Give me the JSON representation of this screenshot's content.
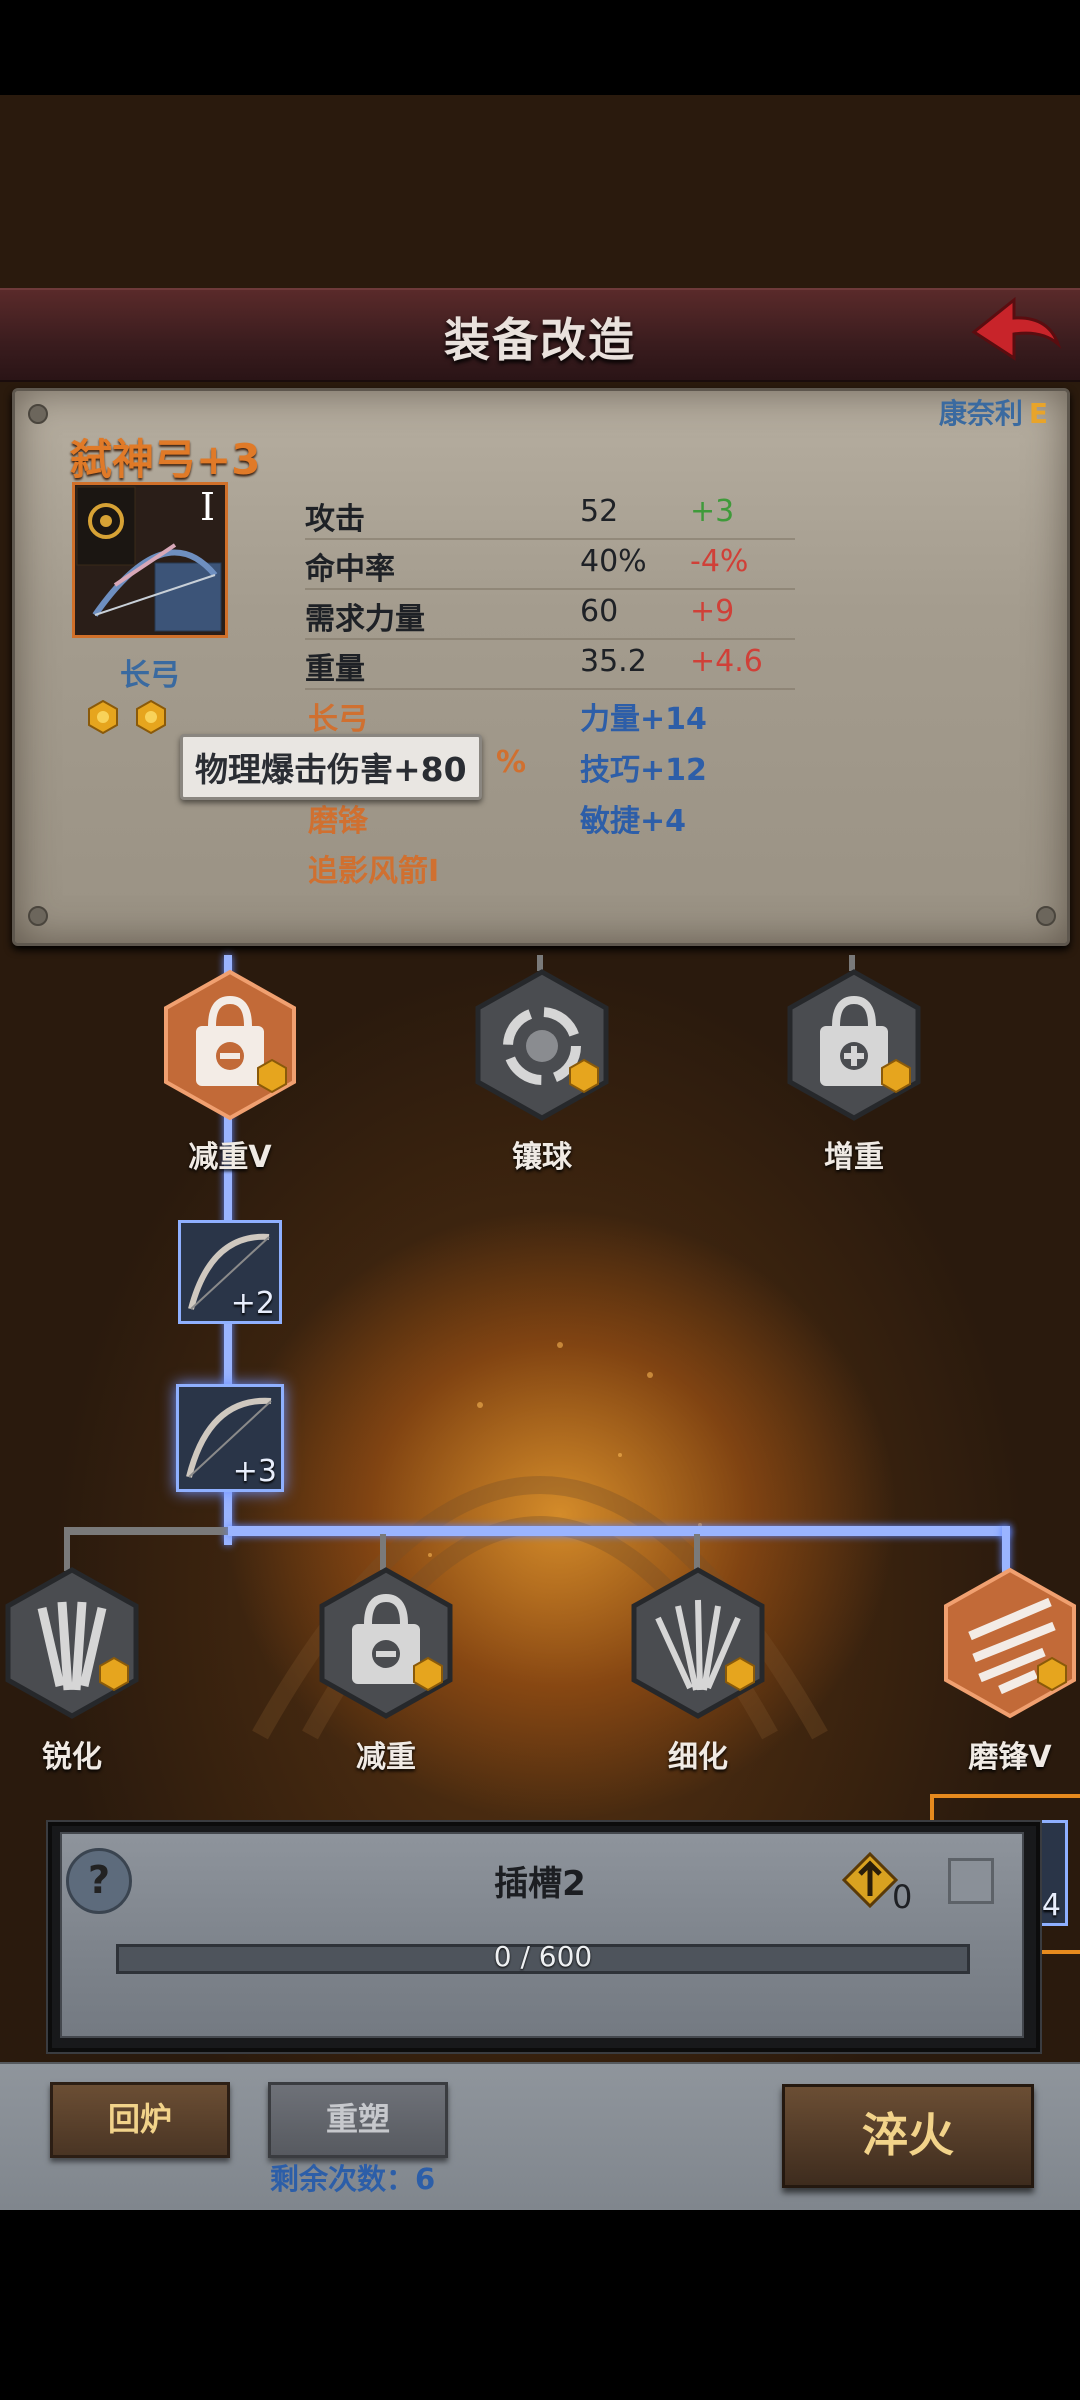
{
  "header": {
    "title": "装备改造"
  },
  "item": {
    "name": "弑神弓+3",
    "owner": "康奈利",
    "owner_grade": "E",
    "tier": "I",
    "type": "长弓"
  },
  "stats": [
    {
      "label": "攻击",
      "value": "52",
      "delta": "+3",
      "kind": "pos"
    },
    {
      "label": "命中率",
      "value": "40%",
      "delta": "-4%",
      "kind": "neg"
    },
    {
      "label": "需求力量",
      "value": "60",
      "delta": "+9",
      "kind": "neg"
    },
    {
      "label": "重量",
      "value": "35.2",
      "delta": "+4.6",
      "kind": "neg"
    }
  ],
  "affixes": [
    "长弓",
    "%",
    "磨锋",
    "追影风箭I"
  ],
  "bonuses": [
    "力量+14",
    "技巧+12",
    "敏捷+4"
  ],
  "tooltip": "物理爆击伤害+80",
  "tree": {
    "top_nodes": [
      "减重V",
      "镶球",
      "增重"
    ],
    "bow_slots": [
      "+2",
      "+3"
    ],
    "bottom_nodes": [
      "锐化",
      "减重",
      "细化",
      "磨锋V"
    ],
    "partial_slot_label": "-4"
  },
  "slot_panel": {
    "title": "插槽2",
    "progress_text": "0 / 600",
    "progress_fraction": 0,
    "count": "0"
  },
  "buttons": {
    "recycle": "回炉",
    "reforge": "重塑",
    "quench": "淬火",
    "remaining": "剩余次数：6"
  }
}
